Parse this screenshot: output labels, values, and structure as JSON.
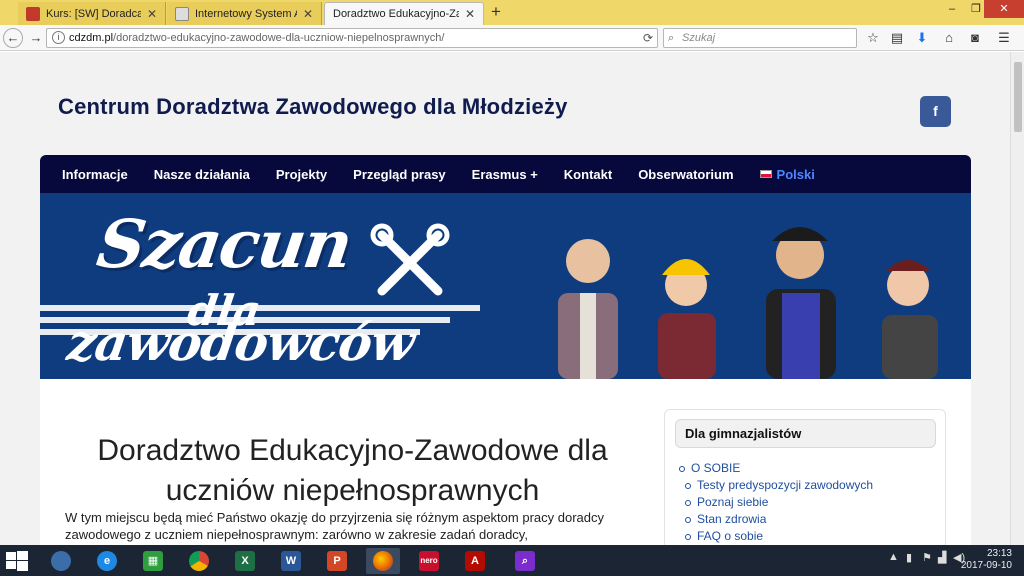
{
  "browser": {
    "tabs": [
      {
        "label": "Kurs: [SW] Doradca zawodo",
        "active": false,
        "favicon_color": "#c0392b"
      },
      {
        "label": "Internetowy System Aktów P",
        "active": false,
        "favicon_color": "#888888"
      },
      {
        "label": "Doradztwo Edukacyjno-Zawodo",
        "active": true,
        "favicon_color": ""
      }
    ],
    "new_tab_label": "+",
    "window_controls": {
      "minimize": "–",
      "restore": "❐",
      "close": "✕"
    },
    "url_host": "cdzdm.pl",
    "url_path": "/doradztwo-edukacyjno-zawodowe-dla-uczniow-niepelnosprawnych/",
    "search_placeholder": "Szukaj",
    "toolbar_icons": [
      "star-icon",
      "clipboard-icon",
      "download-icon",
      "home-icon",
      "pocket-icon",
      "menu-icon"
    ]
  },
  "site": {
    "title": "Centrum Doradztwa Zawodowego dla Młodzieży",
    "facebook_label": "f",
    "nav": [
      "Informacje",
      "Nasze działania",
      "Projekty",
      "Przegląd prasy",
      "Erasmus +",
      "Kontakt",
      "Obserwatorium"
    ],
    "language": "Polski",
    "banner": {
      "line1": "Szacun",
      "line2": "dla",
      "line3": "zawodowców",
      "bg_color": "#0f3c7f"
    }
  },
  "article": {
    "title": "Doradztwo Edukacyjno-Zawodowe dla uczniów niepełnosprawnych",
    "text": "W tym miejscu będą mieć Państwo  okazję do przyjrzenia się różnym aspektom pracy doradcy zawodowego z uczniem niepełnosprawnym: zarówno w zakresie zadań doradcy,"
  },
  "sidebar": {
    "heading": "Dla gimnazjalistów",
    "items": [
      {
        "label": "O SOBIE",
        "level": 0
      },
      {
        "label": "Testy predyspozycji zawodowych",
        "level": 1
      },
      {
        "label": "Poznaj siebie",
        "level": 1
      },
      {
        "label": "Stan zdrowia",
        "level": 1
      },
      {
        "label": "FAQ o sobie",
        "level": 1
      }
    ]
  },
  "taskbar": {
    "clock_time": "23:13",
    "clock_date": "2017-09-10"
  }
}
